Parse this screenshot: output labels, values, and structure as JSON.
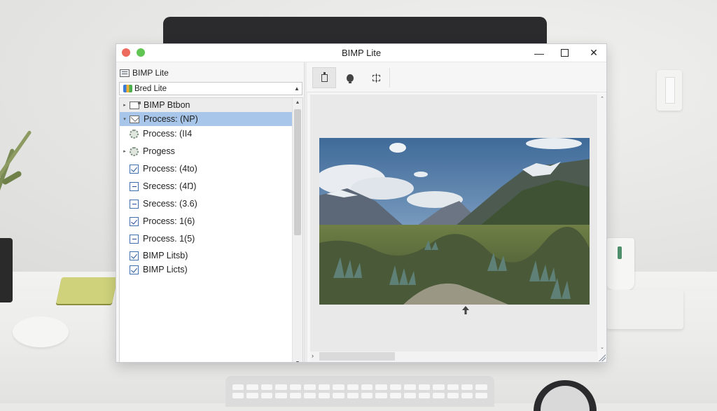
{
  "window": {
    "title": "BIMP Lite"
  },
  "left_pane": {
    "header": "BIMP Lite",
    "combo": {
      "value": "Bred Lite"
    },
    "tree_items": [
      {
        "label": "BIMP Btbon",
        "icon": "document-icon",
        "state": "header"
      },
      {
        "label": "Process: (NP)",
        "icon": "envelope-icon",
        "state": "selected"
      },
      {
        "label": "Process: (II4",
        "icon": "gear-icon",
        "state": "normal"
      },
      {
        "label": "Progess",
        "icon": "gear-icon",
        "state": "normal"
      },
      {
        "label": "Process: (4to)",
        "icon": "checkbox-icon",
        "state": "normal"
      },
      {
        "label": "Srecess: (4Ŋ)",
        "icon": "minus-box-icon",
        "state": "normal"
      },
      {
        "label": "Srecess: (3.6)",
        "icon": "minus-box-icon",
        "state": "normal"
      },
      {
        "label": "Process: 1(6)",
        "icon": "checkbox-icon",
        "state": "normal"
      },
      {
        "label": "Process. 1(5)",
        "icon": "minus-box-icon",
        "state": "normal"
      },
      {
        "label": "BIMP Litsb)",
        "icon": "checkbox-icon",
        "state": "checked"
      },
      {
        "label": "BIMP Licts)",
        "icon": "checkbox-icon",
        "state": "checked"
      }
    ]
  },
  "toolbar": {
    "buttons": [
      {
        "name": "page-icon",
        "active": true
      },
      {
        "name": "drop-icon",
        "active": false
      },
      {
        "name": "crop-icon",
        "active": false
      }
    ]
  },
  "preview": {
    "image": "mountain-valley-landscape"
  },
  "colors": {
    "selection": "#a7c6ea",
    "traffic_red": "#ec6a5e",
    "traffic_green": "#61c554"
  }
}
